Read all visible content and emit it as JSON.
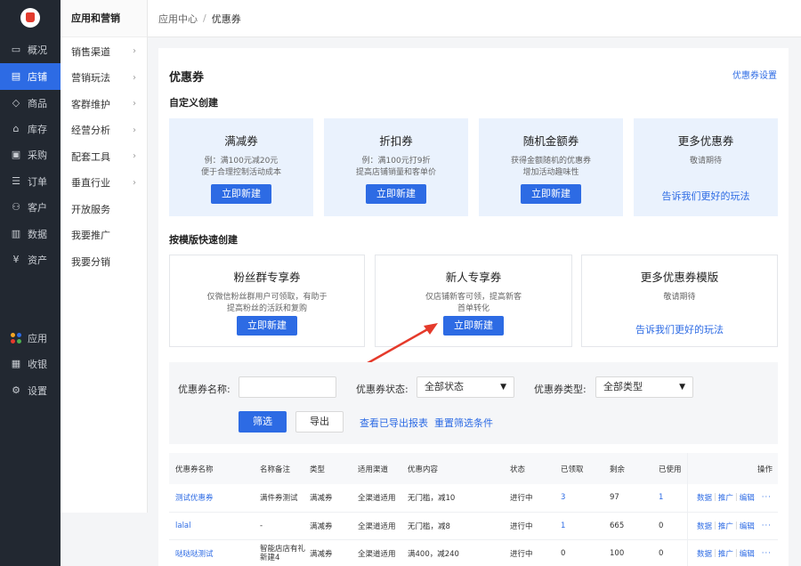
{
  "rail": {
    "items": [
      {
        "label": "概况",
        "icon": "monitor-icon"
      },
      {
        "label": "店铺",
        "icon": "store-icon",
        "active": true
      },
      {
        "label": "商品",
        "icon": "tag-icon"
      },
      {
        "label": "库存",
        "icon": "warehouse-icon"
      },
      {
        "label": "采购",
        "icon": "cart-icon"
      },
      {
        "label": "订单",
        "icon": "list-icon"
      },
      {
        "label": "客户",
        "icon": "user-icon"
      },
      {
        "label": "数据",
        "icon": "chart-icon"
      },
      {
        "label": "资产",
        "icon": "currency-icon"
      }
    ],
    "bottom": [
      {
        "label": "应用",
        "icon": "apps-icon"
      },
      {
        "label": "收银",
        "icon": "cashier-icon"
      },
      {
        "label": "设置",
        "icon": "gear-icon"
      }
    ]
  },
  "subnav": {
    "header": "应用和营销",
    "items": [
      {
        "label": "销售渠道",
        "chevron": true
      },
      {
        "label": "营销玩法",
        "chevron": true
      },
      {
        "label": "客群维护",
        "chevron": true
      },
      {
        "label": "经营分析",
        "chevron": true
      },
      {
        "label": "配套工具",
        "chevron": true
      },
      {
        "label": "垂直行业",
        "chevron": true
      },
      {
        "label": "开放服务",
        "chevron": false
      },
      {
        "label": "我要推广",
        "chevron": false
      },
      {
        "label": "我要分销",
        "chevron": false
      }
    ]
  },
  "breadcrumb": {
    "parent": "应用中心",
    "separator": "/",
    "current": "优惠券"
  },
  "page": {
    "title": "优惠券",
    "settings_link": "优惠券设置"
  },
  "custom_section": {
    "title": "自定义创建",
    "cards": [
      {
        "name": "满减券",
        "desc1": "例：满100元减20元",
        "desc2": "便于合理控制活动成本",
        "button": "立即新建"
      },
      {
        "name": "折扣券",
        "desc1": "例：满100元打9折",
        "desc2": "提高店铺销量和客单价",
        "button": "立即新建"
      },
      {
        "name": "随机金额券",
        "desc1": "获得金额随机的优惠券",
        "desc2": "增加活动趣味性",
        "button": "立即新建"
      },
      {
        "name": "更多优惠券",
        "desc1": "敬请期待",
        "desc2": "",
        "link": "告诉我们更好的玩法"
      }
    ]
  },
  "template_section": {
    "title": "按模版快速创建",
    "cards": [
      {
        "name": "粉丝群专享券",
        "desc1": "仅微信粉丝群用户可领取，有助于",
        "desc2": "提高粉丝的活跃和复购",
        "button": "立即新建"
      },
      {
        "name": "新人专享券",
        "desc1": "仅店铺新客可领，提高新客",
        "desc2": "首单转化",
        "button": "立即新建"
      },
      {
        "name": "更多优惠券模版",
        "desc1": "敬请期待",
        "desc2": "",
        "link": "告诉我们更好的玩法"
      }
    ]
  },
  "filter": {
    "name_label": "优惠券名称:",
    "name_value": "",
    "status_label": "优惠券状态:",
    "status_value": "全部状态",
    "type_label": "优惠券类型:",
    "type_value": "全部类型",
    "filter_button": "筛选",
    "export_button": "导出",
    "view_exports_link": "查看已导出报表",
    "reset_link": "重置筛选条件"
  },
  "table": {
    "columns": [
      "优惠券名称",
      "名称备注",
      "类型",
      "适用渠道",
      "优惠内容",
      "状态",
      "已领取",
      "剩余",
      "已使用",
      "操作"
    ],
    "rows": [
      {
        "name": "测试优惠券",
        "remark": "满件券测试",
        "type": "满减券",
        "channel": "全渠道适用",
        "content": "无门槛，减10",
        "status": "进行中",
        "claimed": "3",
        "remaining": "97",
        "used": "1"
      },
      {
        "name": "lalal",
        "remark": "-",
        "type": "满减券",
        "channel": "全渠道适用",
        "content": "无门槛，减8",
        "status": "进行中",
        "claimed": "1",
        "remaining": "665",
        "used": "0"
      },
      {
        "name": "哒哒哒测试",
        "remark": "智能店店有礼新建4",
        "type": "满减券",
        "channel": "全渠道适用",
        "content": "满400，减240",
        "status": "进行中",
        "claimed": "0",
        "remaining": "100",
        "used": "0"
      }
    ],
    "ops": {
      "data": "数据",
      "promote": "推广",
      "edit": "编辑",
      "more": "···"
    }
  },
  "colors": {
    "accent": "#2d6be4",
    "rail_bg": "#222831",
    "card_bg": "#eaf2fd",
    "arrow": "#e53a2b"
  }
}
